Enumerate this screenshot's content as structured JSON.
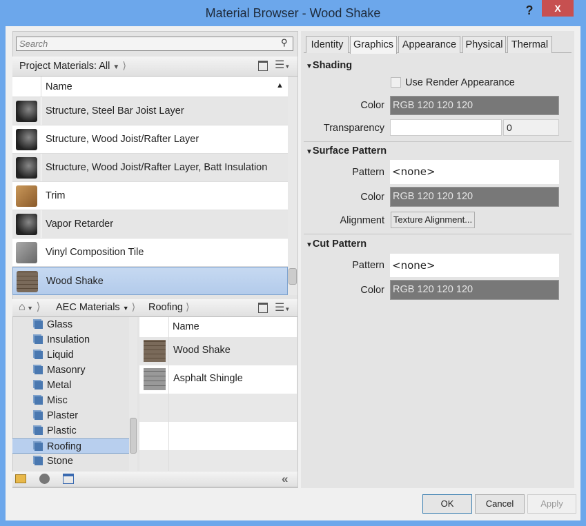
{
  "window": {
    "title": "Material Browser - Wood Shake",
    "help": "?",
    "close": "X"
  },
  "search": {
    "placeholder": "Search"
  },
  "project": {
    "header": "Project Materials: All",
    "column": "Name",
    "rows": [
      {
        "name": "Structure, Steel Bar Joist Layer",
        "thumb": "metal"
      },
      {
        "name": "Structure, Wood Joist/Rafter Layer",
        "thumb": "metal"
      },
      {
        "name": "Structure, Wood Joist/Rafter Layer, Batt Insulation",
        "thumb": "metal"
      },
      {
        "name": "Trim",
        "thumb": "wood"
      },
      {
        "name": "Vapor Retarder",
        "thumb": "metal"
      },
      {
        "name": "Vinyl Composition Tile",
        "thumb": "vct"
      },
      {
        "name": "Wood Shake",
        "thumb": "shake",
        "selected": true
      }
    ]
  },
  "library": {
    "breadcrumb": [
      "AEC Materials",
      "Roofing"
    ],
    "tree": [
      "Glass",
      "Insulation",
      "Liquid",
      "Masonry",
      "Metal",
      "Misc",
      "Plaster",
      "Plastic",
      "Roofing",
      "Stone"
    ],
    "selected_category": "Roofing",
    "column": "Name",
    "items": [
      "Wood Shake",
      "Asphalt Shingle"
    ]
  },
  "tabs": [
    "Identity",
    "Graphics",
    "Appearance",
    "Physical",
    "Thermal"
  ],
  "active_tab": "Graphics",
  "shading": {
    "title": "Shading",
    "use_render": "Use Render Appearance",
    "color_label": "Color",
    "color": "RGB 120 120 120",
    "transparency_label": "Transparency",
    "transparency": "0"
  },
  "surface": {
    "title": "Surface Pattern",
    "pattern_label": "Pattern",
    "pattern": "<none>",
    "color_label": "Color",
    "color": "RGB 120 120 120",
    "alignment_label": "Alignment",
    "alignment_btn": "Texture Alignment..."
  },
  "cut": {
    "title": "Cut Pattern",
    "pattern_label": "Pattern",
    "pattern": "<none>",
    "color_label": "Color",
    "color": "RGB 120 120 120"
  },
  "buttons": {
    "ok": "OK",
    "cancel": "Cancel",
    "apply": "Apply"
  }
}
